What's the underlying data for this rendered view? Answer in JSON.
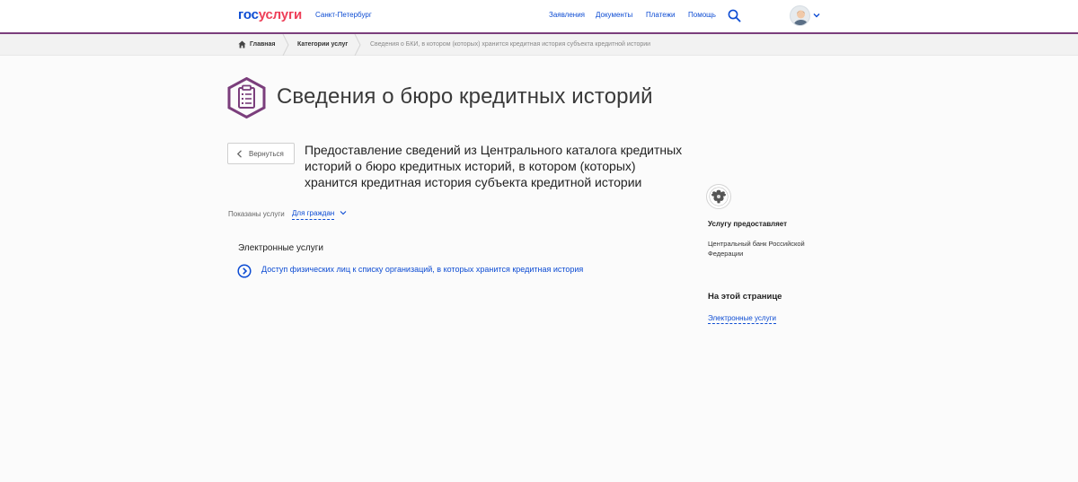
{
  "header": {
    "logo_gos": "гос",
    "logo_uslugi": "услуги",
    "city": "Санкт-Петербург",
    "nav": [
      "Заявления",
      "Документы",
      "Платежи",
      "Помощь"
    ]
  },
  "breadcrumbs": {
    "home": "Главная",
    "categories": "Категории услуг",
    "current": "Сведения о БКИ, в котором (которых) хранится кредитная история субъекта кредитной истории"
  },
  "main": {
    "title": "Сведения о бюро кредитных историй",
    "back_label": "Вернуться",
    "service_title": "Предоставление сведений из Центрального каталога кредитных историй о бюро кредитных историй, в котором (которых) хранится кредитная история субъекта кредитной истории",
    "shown_label": "Показаны услуги",
    "shown_value": "Для граждан",
    "section_heading": "Электронные услуги",
    "service_link": "Доступ физических лиц к списку организаций, в которых хранится кредитная история"
  },
  "sidebar": {
    "provider_heading": "Услугу предоставляет",
    "provider_name": "Центральный банк Российской Федерации",
    "onpage_heading": "На этой странице",
    "onpage_link": "Электронные услуги"
  },
  "colors": {
    "accent_blue": "#0d4cd3",
    "logo_red": "#ee3f58",
    "brand_purple": "#7b3e7c"
  },
  "icons": [
    "search-icon",
    "avatar",
    "chevron-down-icon",
    "home-icon",
    "clipboard-icon",
    "chevron-left-icon",
    "arrow-circle-right-icon",
    "emblem-icon"
  ]
}
